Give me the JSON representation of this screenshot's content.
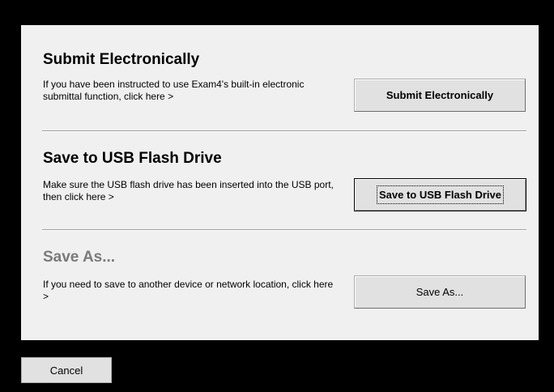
{
  "sections": [
    {
      "heading": "Submit Electronically",
      "description": "If you have been instructed to use Exam4's built-in electronic submittal function, click here >",
      "button_label": "Submit Electronically"
    },
    {
      "heading": "Save to USB Flash Drive",
      "description": "Make sure the USB flash drive has been inserted into the USB port, then click here >",
      "button_label": "Save to USB Flash Drive"
    },
    {
      "heading": "Save As...",
      "description": "If you need to save to another device or network location, click here >",
      "button_label": "Save As..."
    }
  ],
  "footer": {
    "cancel_label": "Cancel"
  },
  "colors": {
    "background": "#000000",
    "panel": "#f0f0f0",
    "disabled_heading": "#7a7a7a",
    "button_face": "#e1e1e1"
  }
}
